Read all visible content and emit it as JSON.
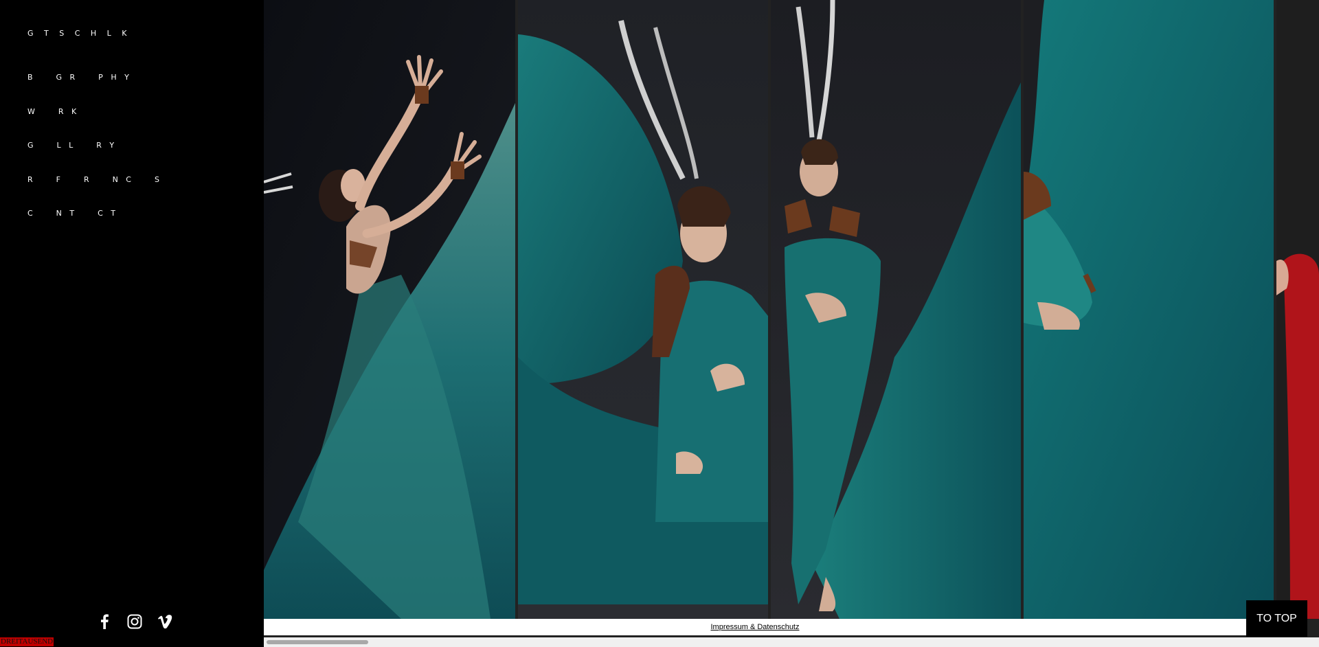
{
  "site": {
    "logo": "G T S C H L K"
  },
  "nav": {
    "items": [
      {
        "label": "B    G R    P H Y"
      },
      {
        "label": "W    R K"
      },
      {
        "label": "G    L L    R Y"
      },
      {
        "label": "R    F    R    N C    S"
      },
      {
        "label": "C    N T    C T"
      }
    ]
  },
  "social": {
    "icons": [
      "facebook-icon",
      "instagram-icon",
      "vimeo-icon"
    ]
  },
  "badge": {
    "label": "DREITAUSEND"
  },
  "gallery": {
    "accent_teal": "#0e6f6c",
    "accent_red": "#b0141a"
  },
  "footer": {
    "link_label": "Impressum & Datenschutz"
  },
  "to_top": {
    "label": "TO TOP"
  }
}
